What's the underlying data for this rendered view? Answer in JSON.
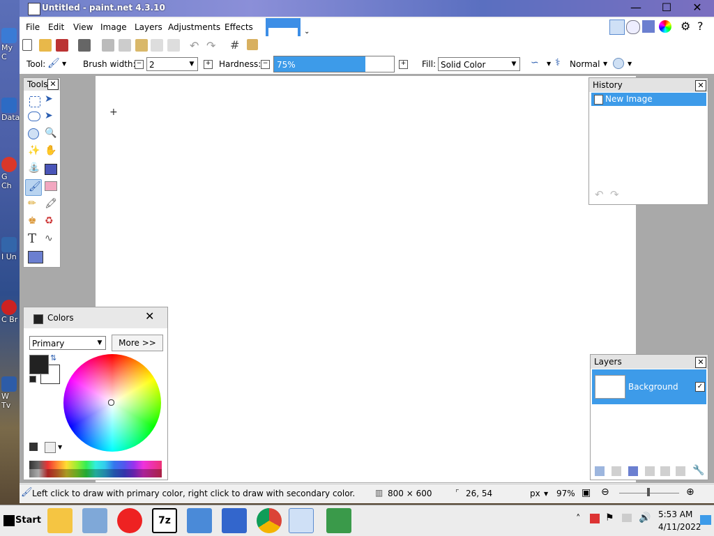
{
  "window": {
    "title": "Untitled - paint.net 4.3.10",
    "minimize": "—",
    "maximize": "☐",
    "close": "✕"
  },
  "desktop": {
    "icons": [
      {
        "label": "My C"
      },
      {
        "label": "Data"
      },
      {
        "label": "G Ch"
      },
      {
        "label": "I Un"
      },
      {
        "label": "C Br"
      },
      {
        "label": "W Tv"
      }
    ]
  },
  "menu": {
    "items": [
      "File",
      "Edit",
      "View",
      "Image",
      "Layers",
      "Adjustments",
      "Effects"
    ]
  },
  "toolbar": {
    "tool_label": "Tool:",
    "brush_width_label": "Brush width:",
    "brush_width_value": "2",
    "hardness_label": "Hardness:",
    "hardness_value": "75%",
    "hardness_fraction": 0.75,
    "fill_label": "Fill:",
    "fill_value": "Solid Color",
    "blend_mode": "Normal",
    "minus": "⊟",
    "plus": "⊞"
  },
  "tools_panel": {
    "title": "Tools",
    "close": "✕",
    "text_tool": "T"
  },
  "history_panel": {
    "title": "History",
    "close": "✕",
    "items": [
      "New Image"
    ]
  },
  "colors_panel": {
    "title": "Colors",
    "close": "✕",
    "mode": "Primary",
    "more_button": "More >>",
    "primary_color": "#222222",
    "secondary_color": "#ffffff"
  },
  "layers_panel": {
    "title": "Layers",
    "close": "✕",
    "layers": [
      {
        "name": "Background",
        "visible": true
      }
    ]
  },
  "status": {
    "hint": "Left click to draw with primary color, right click to draw with secondary color.",
    "image_size": "800 × 600",
    "cursor_pos": "26, 54",
    "units": "px",
    "zoom": "97%"
  },
  "taskbar": {
    "start": "Start",
    "time": "5:53 AM",
    "date": "4/11/2022",
    "tray_up": "˄"
  }
}
